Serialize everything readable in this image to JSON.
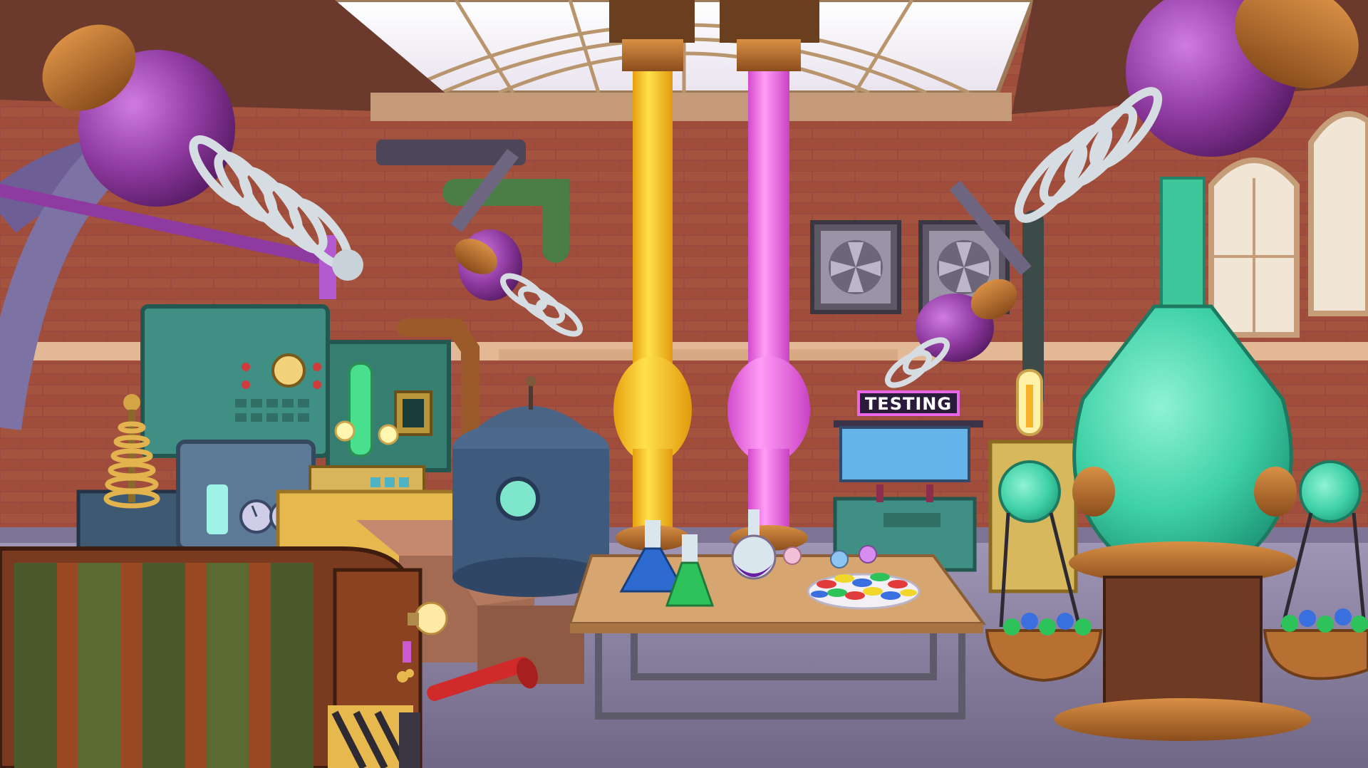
{
  "scene": {
    "name": "candy-lab-room",
    "sign_text": "TESTING"
  },
  "palette": {
    "wall_brick": "#9a4a3e",
    "wall_mortar": "#b7675a",
    "floor": "#8f86a6",
    "trim": "#e8c9a4",
    "yellow_liquid": "#f7c21c",
    "pink_liquid": "#f06ee8",
    "green_liquid": "#39d9a8",
    "purple_glass": "#8f3aa0",
    "copper": "#b06a2c",
    "teal_machine": "#3f8f84",
    "sign_bg": "#2b1b3a",
    "sign_text": "#ffffff",
    "sign_border": "#e866e6"
  }
}
